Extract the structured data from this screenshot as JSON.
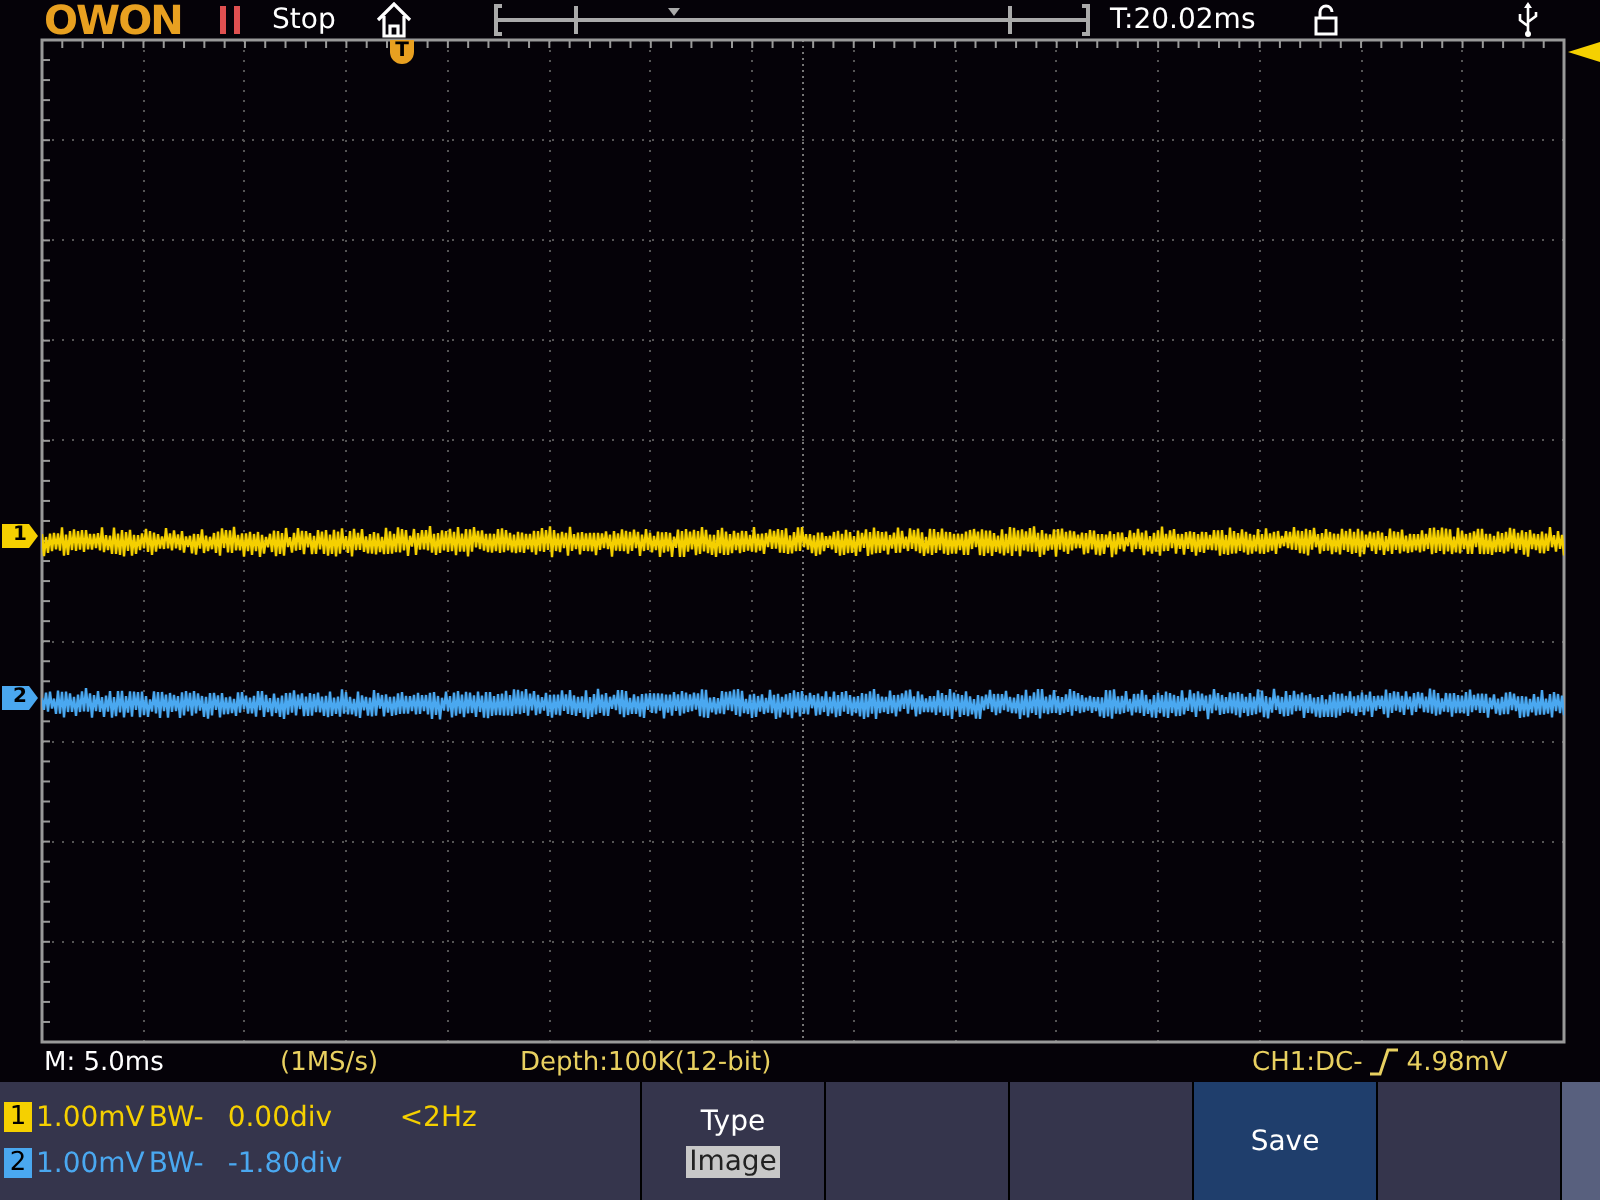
{
  "top_bar": {
    "brand": "OWON",
    "run_state": "Stop",
    "trigger_time": "T:20.02ms",
    "trigger_marker": "T"
  },
  "markers": [
    {
      "label": "1",
      "color": "#f5d000"
    },
    {
      "label": "2",
      "color": "#4aa8f0"
    }
  ],
  "status_line": {
    "timebase": "M: 5.0ms",
    "sample_rate": "(1MS/s)",
    "depth": "Depth:100K(12-bit)",
    "trigger": "CH1:DC-",
    "trigger_level": "4.98mV"
  },
  "channels": [
    {
      "number": "1",
      "scale": "1.00mV",
      "bandwidth": "BW-",
      "offset": "0.00div",
      "frequency": "<2Hz",
      "color": "#f5d000"
    },
    {
      "number": "2",
      "scale": "1.00mV",
      "bandwidth": "BW-",
      "offset": "-1.80div",
      "color": "#4aa8f0"
    }
  ],
  "softkeys": [
    {
      "label": "Type",
      "value": "Image",
      "selected": false
    },
    {
      "selected": false
    },
    {
      "selected": false
    },
    {
      "label": "Save",
      "selected": true
    },
    {
      "selected": false
    }
  ]
}
